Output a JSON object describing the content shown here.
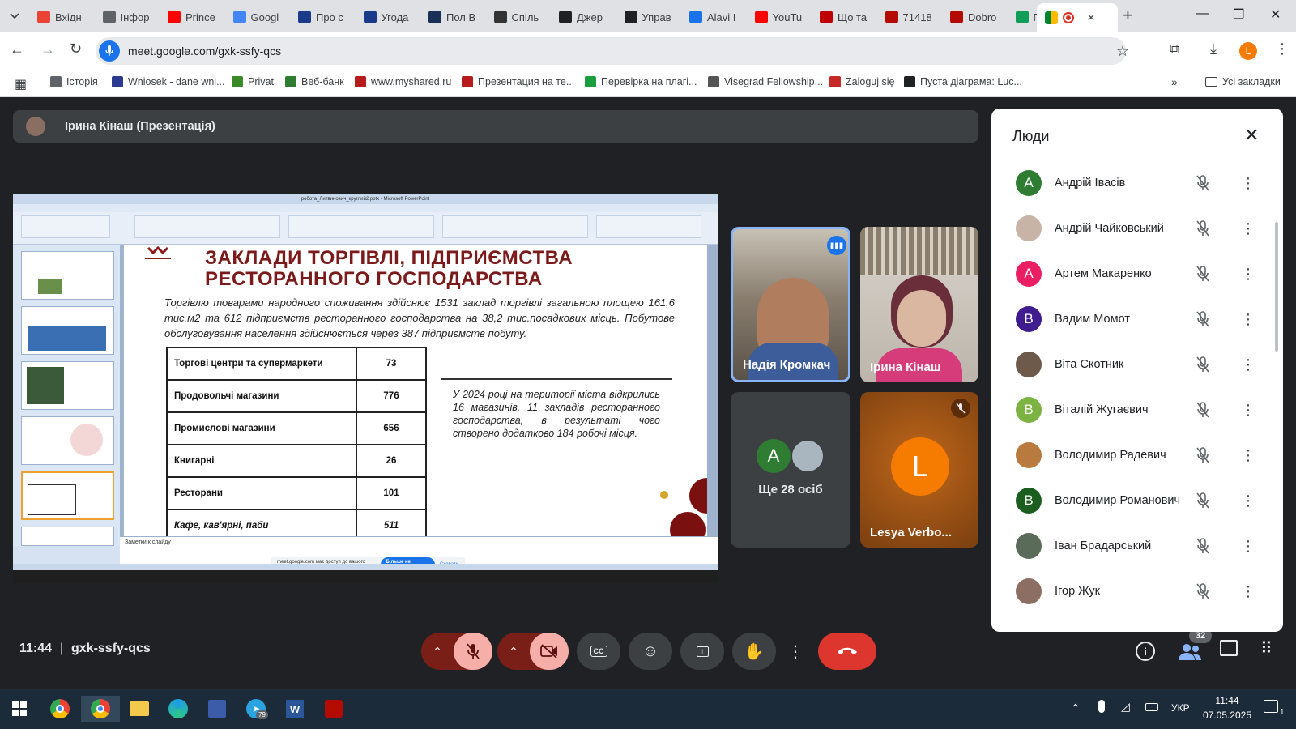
{
  "browser": {
    "tabs": [
      {
        "title": "Вхідн",
        "icon": "gmail-icon",
        "color": "#ea4335"
      },
      {
        "title": "Інфор",
        "icon": "globe-icon",
        "color": "#5f6368"
      },
      {
        "title": "Prince",
        "icon": "youtube-icon",
        "color": "#ff0000"
      },
      {
        "title": "Googl",
        "icon": "translate-icon",
        "color": "#4285f4"
      },
      {
        "title": "Про с",
        "icon": "trident-icon",
        "color": "#1a3a8a"
      },
      {
        "title": "Угода",
        "icon": "trident-icon",
        "color": "#1a3a8a"
      },
      {
        "title": "Пол В",
        "icon": "mail-icon",
        "color": "#1a2f55"
      },
      {
        "title": "Спіль",
        "icon": "app-icon",
        "color": "#333333"
      },
      {
        "title": "Джер",
        "icon": "openai-icon",
        "color": "#202124"
      },
      {
        "title": "Управ",
        "icon": "openai-icon",
        "color": "#202124"
      },
      {
        "title": "Alavi I",
        "icon": "cap-icon",
        "color": "#1a73e8"
      },
      {
        "title": "YouTu",
        "icon": "youtube-icon",
        "color": "#ff0000"
      },
      {
        "title": "Що та",
        "icon": "news-icon",
        "color": "#c00000"
      },
      {
        "title": "71418",
        "icon": "pdf-icon",
        "color": "#b30b00"
      },
      {
        "title": "Dobro",
        "icon": "pdf-icon",
        "color": "#b30b00"
      },
      {
        "title": "ПС-Р",
        "icon": "sheets-icon",
        "color": "#0f9d58"
      }
    ],
    "active_tab": {
      "icon": "meet-icon",
      "close": "✕"
    },
    "new_tab": "+",
    "url": "meet.google.com/gxk-ssfy-qcs",
    "profile_letter": "L",
    "bookmarks": [
      {
        "label": "Історія",
        "icon": "history-icon",
        "color": "#5f6368"
      },
      {
        "label": "Wniosek - dane wni...",
        "icon": "layers-icon",
        "color": "#2b3a8f"
      },
      {
        "label": "Privat",
        "icon": "privat-icon",
        "color": "#3a8a2a"
      },
      {
        "label": "Веб-банк",
        "icon": "bank-icon",
        "color": "#2e7d32"
      },
      {
        "label": "www.myshared.ru",
        "icon": "slides-icon",
        "color": "#b71c1c"
      },
      {
        "label": "Презентация на те...",
        "icon": "slides-icon",
        "color": "#b71c1c"
      },
      {
        "label": "Перевірка на плагі...",
        "icon": "leaf-icon",
        "color": "#1b9e3e"
      },
      {
        "label": "Visegrad Fellowship...",
        "icon": "dots-icon",
        "color": "#555555"
      },
      {
        "label": "Zaloguj się",
        "icon": "arrow-icon",
        "color": "#c62828"
      },
      {
        "label": "Пуста діаграма: Luc...",
        "icon": "lucid-icon",
        "color": "#202124"
      }
    ],
    "all_bookmarks": "Усі закладки"
  },
  "presenter": {
    "name": "Ірина Кінаш (Презентація)"
  },
  "ppt": {
    "window_title": "робота_Литвинович_круглий2.pptx - Microsoft PowerPoint",
    "notes_placeholder": "Заметки к слайду",
    "share_message": "meet.google.com має доступ до вашого екрана.",
    "share_stop": "Більше не ділитися",
    "share_hide": "Сховати",
    "slide": {
      "title_line1": "ЗАКЛАДИ ТОРГІВЛІ, ПІДПРИЄМСТВА",
      "title_line2": "РЕСТОРАННОГО ГОСПОДАРСТВА",
      "intro": "Торгівлю товарами народного споживання здійснює 1531 заклад торгівлі загальною площею 161,6 тис.м2 та 612 підприємств ресторанного господарства на 38,2 тис.посадкових місць. Побутове обслуговування населення здійснюється через 387 підприємств побуту.",
      "rows": [
        {
          "name": "Торгові центри та супермаркети",
          "value": "73"
        },
        {
          "name": "Продовольчі магазини",
          "value": "776"
        },
        {
          "name": "Промислові магазини",
          "value": "656"
        },
        {
          "name": "Книгарні",
          "value": "26"
        },
        {
          "name": "Ресторани",
          "value": "101"
        },
        {
          "name": "Кафе, кав'ярні, паби",
          "value": "511"
        }
      ],
      "note": "У 2024 році на території міста відкрились 16 магазинів, 11 закладів ресторанного господарства, в результаті чого створено додатково 184 робочі місця."
    }
  },
  "tiles": [
    {
      "name": "Надія Кромкач"
    },
    {
      "name": "Ірина Кінаш"
    },
    {
      "name": "Ще 28 осіб",
      "avatar_letter": "A"
    },
    {
      "name": "Lesya Verbo...",
      "letter": "L"
    }
  ],
  "bottom": {
    "time": "11:44",
    "separator": "|",
    "meeting_code": "gxk-ssfy-qcs",
    "people_count": "32"
  },
  "people_panel": {
    "title": "Люди",
    "people": [
      {
        "name": "Андрій Івасів",
        "letter": "А",
        "color": "#2e7d32"
      },
      {
        "name": "Андрій Чайковський",
        "letter": "",
        "color": "#c8b4a6"
      },
      {
        "name": "Артем Макаренко",
        "letter": "А",
        "color": "#e91e63"
      },
      {
        "name": "Вадим Момот",
        "letter": "В",
        "color": "#3f1d8f"
      },
      {
        "name": "Віта Скотник",
        "letter": "",
        "color": "#6d5a4a"
      },
      {
        "name": "Віталій Жугаєвич",
        "letter": "В",
        "color": "#7cb342"
      },
      {
        "name": "Володимир Радевич",
        "letter": "",
        "color": "#b87a3e"
      },
      {
        "name": "Володимир Романович",
        "letter": "В",
        "color": "#1b5e20"
      },
      {
        "name": "Іван Брадарський",
        "letter": "",
        "color": "#5b6b5a"
      },
      {
        "name": "Ігор Жук",
        "letter": "",
        "color": "#8d6e63"
      }
    ]
  },
  "taskbar": {
    "lang": "УКР",
    "time": "11:44",
    "date": "07.05.2025",
    "telegram_badge": "79",
    "notif_count": "1"
  }
}
